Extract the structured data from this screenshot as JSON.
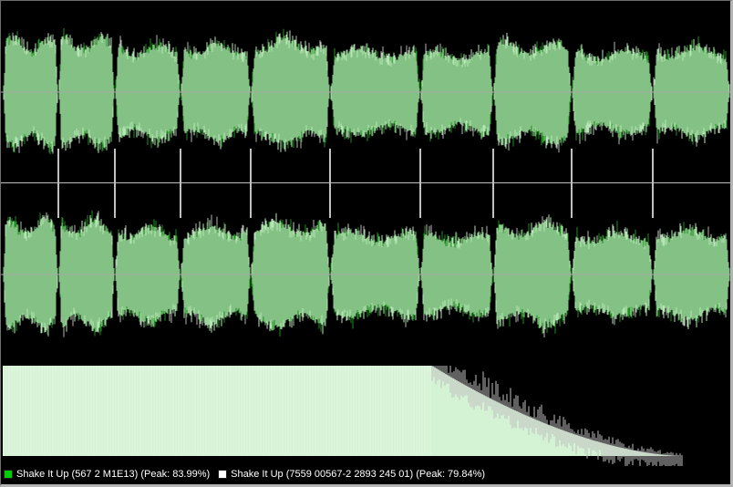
{
  "colors": {
    "background": "#000000",
    "wave_fill": "#84c184",
    "wave_light": "#b5e6b5",
    "wave_dark_green": "#1d8f1d",
    "wave_gray": "#b6b6b6",
    "center_line": "#a8a8a8",
    "divider_line": "#bdbdbd",
    "marker_line": "#ffffff",
    "spectrum_fill": "#d4f2d4",
    "spectrum_gray": "#bfbfbf"
  },
  "legend": {
    "items": [
      {
        "label": "Shake It Up (567 2 M1E13) (Peak: 83.99%)",
        "color": "#00d000"
      },
      {
        "label": "Shake It Up (7559 00567-2 2893 245 01) (Peak: 79.84%)",
        "color": "#ffffff"
      }
    ]
  },
  "tracks": {
    "count": 10,
    "relative_lengths": [
      68,
      69,
      81,
      86,
      97,
      111,
      89,
      97,
      99,
      95
    ],
    "relative_levels": [
      1.0,
      1.0,
      0.88,
      0.9,
      0.97,
      0.8,
      0.76,
      0.93,
      0.78,
      0.84
    ]
  },
  "spectrum": {
    "flat_until": 0.59,
    "end": 0.935
  }
}
